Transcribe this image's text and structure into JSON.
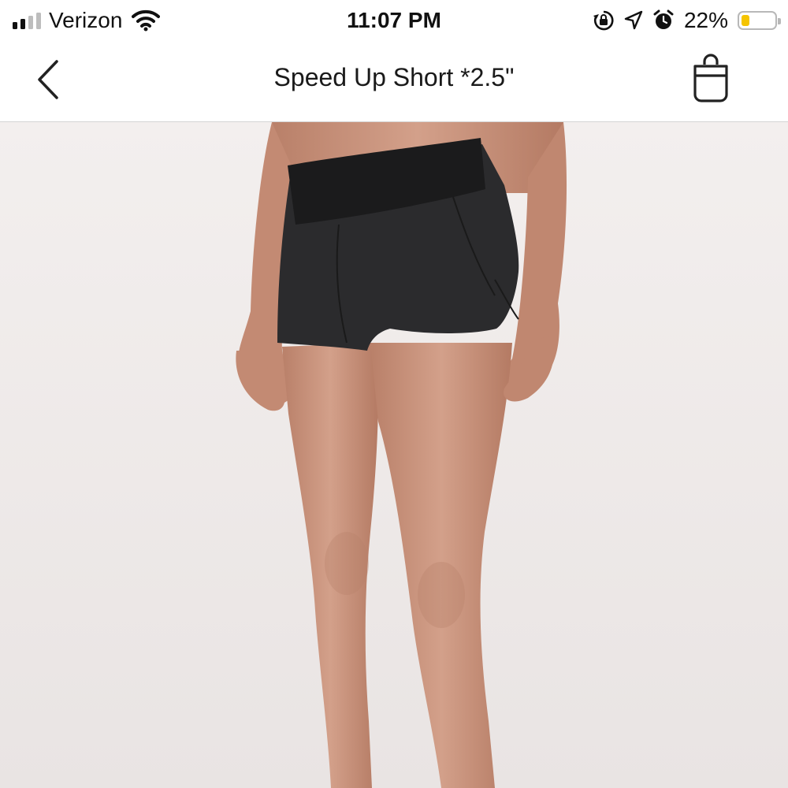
{
  "status_bar": {
    "carrier": "Verizon",
    "time": "11:07 PM",
    "battery_percent": "22%",
    "battery_level": 0.22,
    "signal_bars_filled": 2,
    "icons": [
      "signal-bars-icon",
      "wifi-icon",
      "rotation-lock-icon",
      "location-arrow-icon",
      "alarm-icon",
      "battery-icon"
    ]
  },
  "nav": {
    "title": "Speed Up Short *2.5\"",
    "back_icon": "chevron-left-icon",
    "bag_icon": "shopping-bag-icon"
  },
  "colors": {
    "text": "#111111",
    "battery_fill": "#f5c400",
    "background": "#f0eceb",
    "shorts": "#2b2b2d",
    "skin": "#c9927b"
  }
}
